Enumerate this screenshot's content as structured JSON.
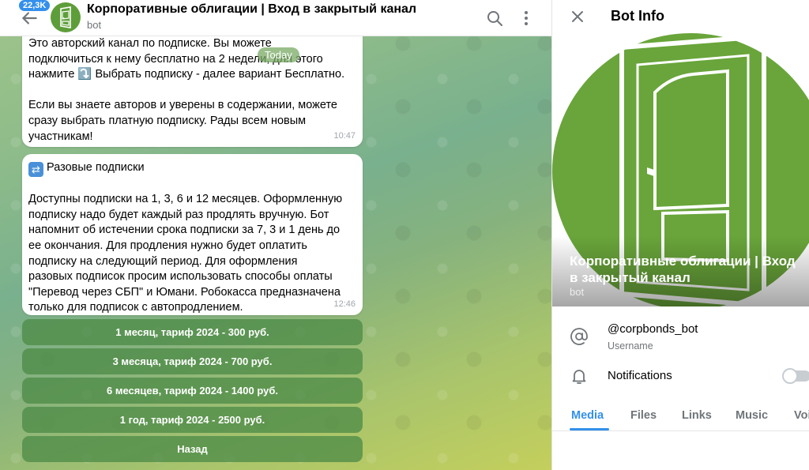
{
  "header": {
    "unread_count": "22,3K",
    "title": "Корпоративные облигации | Вход в закрытый канал",
    "subtitle": "bot"
  },
  "date_separator": "Today",
  "messages": [
    {
      "text": "Это авторский канал по подписке. Вы можете\nподключиться к нему бесплатно на 2 недели, для этого\nнажмите ⤵️ Выбрать подписку - далее вариант Бесплатно.\n\nЕсли вы знаете авторов и уверены в содержании, можете\nсразу выбрать платную подписку. Рады всем новым\nучастникам!",
      "time": "10:47"
    },
    {
      "heading": "Разовые подписки",
      "text": "Доступны подписки на 1, 3, 6 и 12 месяцев. Оформленную\nподписку надо будет каждый раз продлять вручную. Бот\nнапомнит об истечении срока подписки за 7, 3 и 1 день до\nее окончания. Для продления нужно будет оплатить\nподписку на следующий период. Для оформления\nразовых подписок просим использовать способы оплаты\n\"Перевод через СБП\" и Юмани. Робокасса предназначена\nтолько для подписок с автопродлением.",
      "time": "12:46"
    }
  ],
  "keyboard": [
    "1 месяц, тариф 2024 - 300 руб.",
    "3 месяца, тариф 2024 - 700 руб.",
    "6 месяцев, тариф 2024 - 1400 руб.",
    "1 год, тариф 2024 - 2500 руб.",
    "Назад"
  ],
  "info": {
    "title": "Bot Info",
    "name": "Корпоративные облигации | Вход в закрытый канал",
    "sub": "bot",
    "username": "@corpbonds_bot",
    "username_label": "Username",
    "notifications_label": "Notifications",
    "notifications_on": false,
    "tabs": [
      "Media",
      "Files",
      "Links",
      "Music",
      "Voice"
    ]
  },
  "colors": {
    "accent": "#3390ec",
    "avatar_green": "#69a53a",
    "keyboard_button": "#4e8c48"
  }
}
